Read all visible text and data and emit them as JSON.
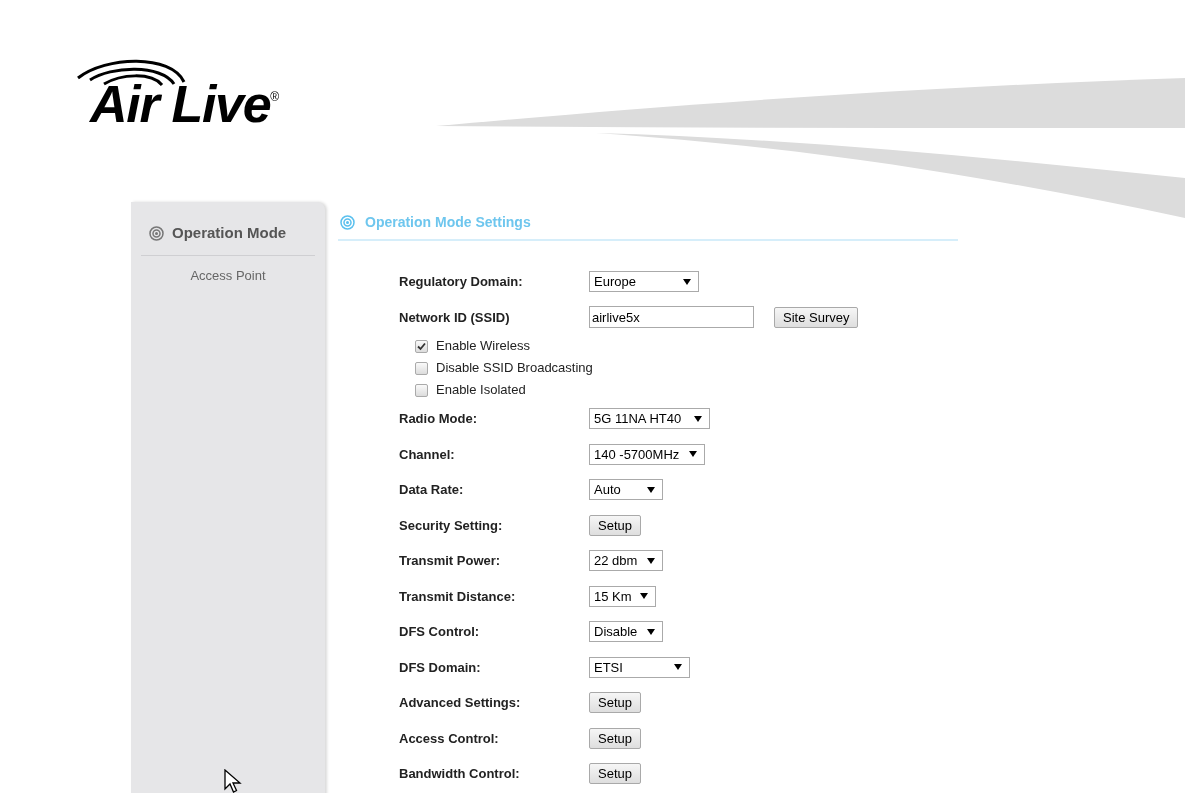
{
  "logo": {
    "text": "Air Live",
    "mark": "®"
  },
  "sidebar": {
    "title": "Operation Mode",
    "items": [
      {
        "label": "Access Point",
        "selected": false
      }
    ]
  },
  "section": {
    "title": "Operation Mode Settings"
  },
  "rows": [
    {
      "kind": "select",
      "label": "Regulatory Domain:",
      "value": "Europe"
    },
    {
      "kind": "input",
      "label": "Network ID (SSID)",
      "value": "airlive5x",
      "button": "Site Survey"
    },
    {
      "kind": "checkbox",
      "label": "Enable Wireless",
      "checked": true
    },
    {
      "kind": "checkbox",
      "label": "Disable SSID Broadcasting",
      "checked": false
    },
    {
      "kind": "checkbox",
      "label": "Enable Isolated",
      "checked": false
    },
    {
      "kind": "select",
      "label": "Radio Mode:",
      "value": "5G 11NA HT40"
    },
    {
      "kind": "select",
      "label": "Channel:",
      "value": "140 -5700MHz"
    },
    {
      "kind": "select",
      "label": "Data Rate:",
      "value": "Auto"
    },
    {
      "kind": "button",
      "label": "Security Setting:",
      "button": "Setup"
    },
    {
      "kind": "select",
      "label": "Transmit Power:",
      "value": "22 dbm"
    },
    {
      "kind": "select",
      "label": "Transmit Distance:",
      "value": "15 Km"
    },
    {
      "kind": "select",
      "label": "DFS Control:",
      "value": "Disable"
    },
    {
      "kind": "select",
      "label": "DFS Domain:",
      "value": "ETSI"
    },
    {
      "kind": "button",
      "label": "Advanced Settings:",
      "button": "Setup"
    },
    {
      "kind": "button",
      "label": "Access Control:",
      "button": "Setup"
    },
    {
      "kind": "button",
      "label": "Bandwidth Control:",
      "button": "Setup"
    }
  ]
}
